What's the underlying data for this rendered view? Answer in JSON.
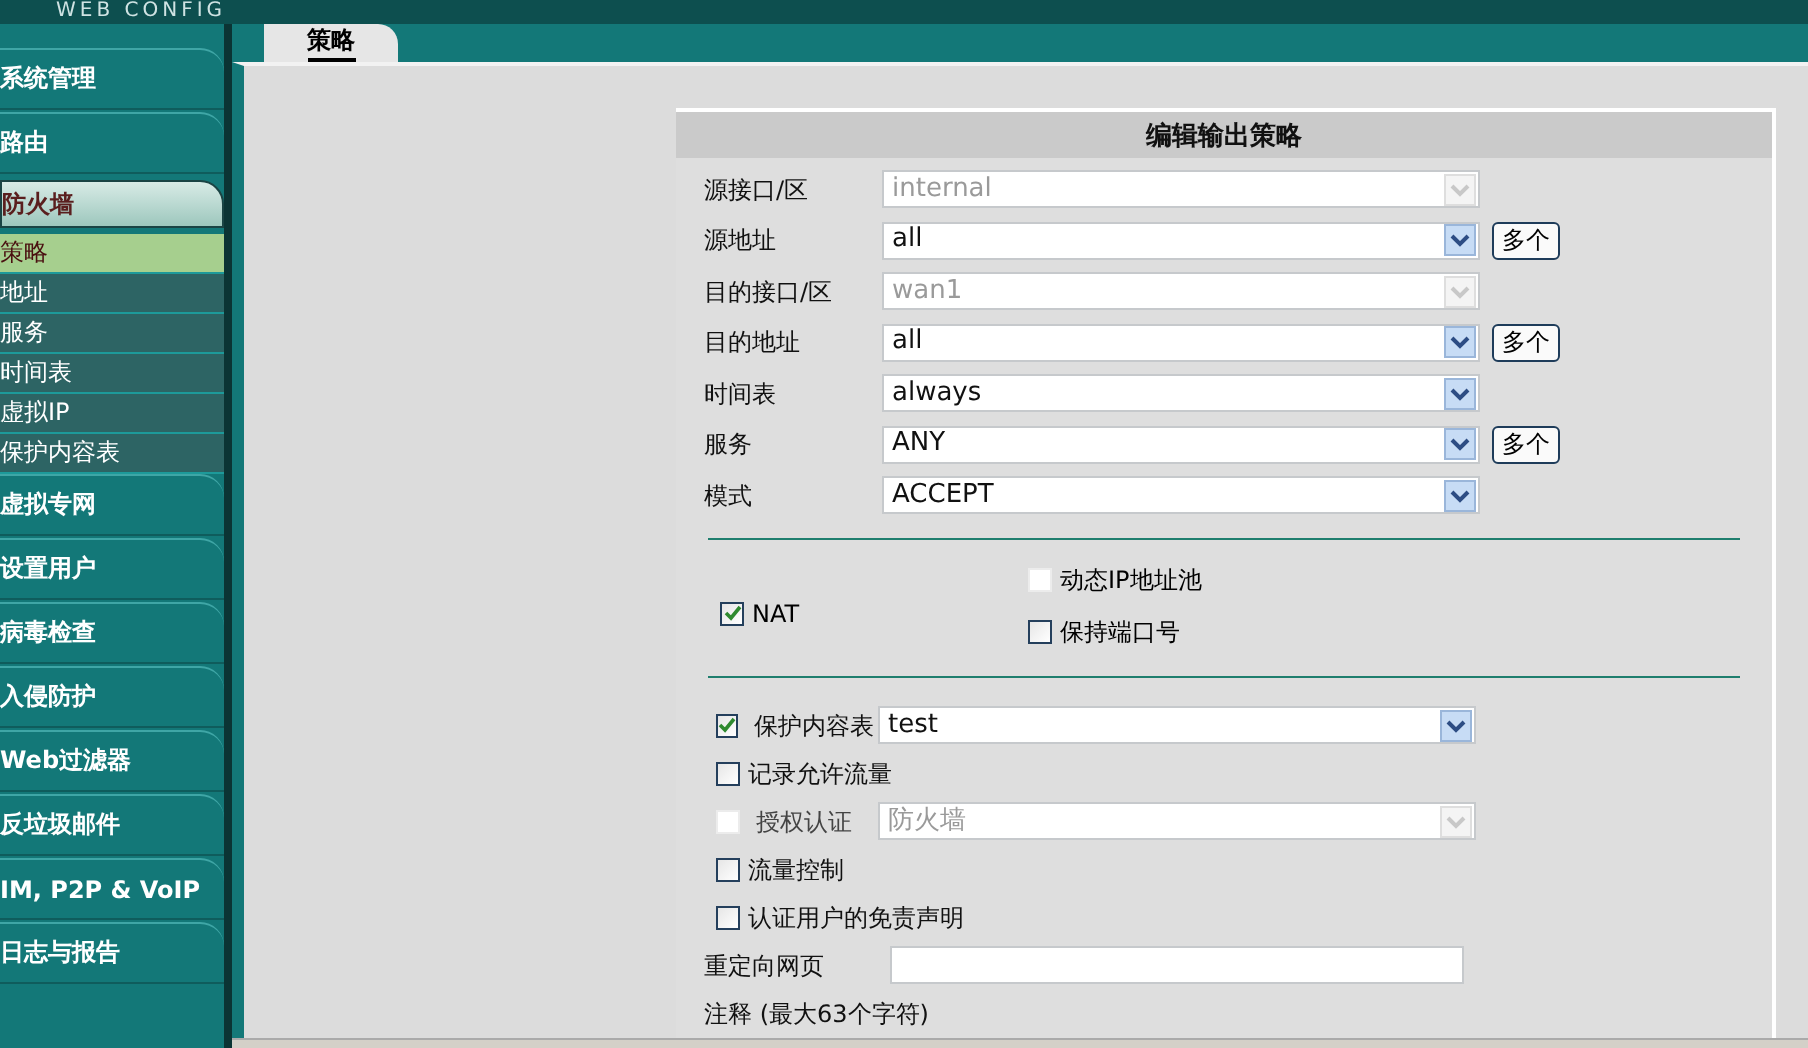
{
  "header": {
    "logo_text": "WEB CONFIG"
  },
  "sidebar": {
    "items": [
      {
        "label": "系统管理",
        "expanded": false
      },
      {
        "label": "路由",
        "expanded": false
      },
      {
        "label": "防火墙",
        "expanded": true,
        "children": [
          {
            "label": "策略",
            "selected": true
          },
          {
            "label": "地址",
            "selected": false
          },
          {
            "label": "服务",
            "selected": false
          },
          {
            "label": "时间表",
            "selected": false
          },
          {
            "label": "虚拟IP",
            "selected": false
          },
          {
            "label": "保护内容表",
            "selected": false
          }
        ]
      },
      {
        "label": "虚拟专网",
        "expanded": false
      },
      {
        "label": "设置用户",
        "expanded": false
      },
      {
        "label": "病毒检查",
        "expanded": false
      },
      {
        "label": "入侵防护",
        "expanded": false
      },
      {
        "label": "Web过滤器",
        "expanded": false
      },
      {
        "label": "反垃圾邮件",
        "expanded": false
      },
      {
        "label": "IM, P2P & VoIP",
        "expanded": false
      },
      {
        "label": "日志与报告",
        "expanded": false
      }
    ]
  },
  "tabs": [
    {
      "label": "策略",
      "selected": true
    }
  ],
  "form": {
    "title": "编辑输出策略",
    "fields": [
      {
        "label": "源接口/区",
        "value": "internal",
        "disabled": true
      },
      {
        "label": "源地址",
        "value": "all",
        "disabled": false,
        "multi_button": "多个"
      },
      {
        "label": "目的接口/区",
        "value": "wan1",
        "disabled": true
      },
      {
        "label": "目的地址",
        "value": "all",
        "disabled": false,
        "multi_button": "多个"
      },
      {
        "label": "时间表",
        "value": "always",
        "disabled": false
      },
      {
        "label": "服务",
        "value": "ANY",
        "disabled": false,
        "multi_button": "多个"
      },
      {
        "label": "模式",
        "value": "ACCEPT",
        "disabled": false
      }
    ],
    "nat": {
      "label": "NAT",
      "checked": true,
      "options": [
        {
          "label": "动态IP地址池",
          "checked": false,
          "disabled": true
        },
        {
          "label": "保持端口号",
          "checked": false,
          "disabled": false
        }
      ]
    },
    "options": [
      {
        "kind": "checkbox_select",
        "label": "保护内容表",
        "checked": true,
        "disabled": false,
        "value": "test"
      },
      {
        "kind": "checkbox",
        "label": "记录允许流量",
        "checked": false,
        "disabled": false
      },
      {
        "kind": "checkbox_select",
        "label": "授权认证",
        "checked": false,
        "disabled": true,
        "value": "防火墙"
      },
      {
        "kind": "checkbox",
        "label": "流量控制",
        "checked": false,
        "disabled": false
      },
      {
        "kind": "checkbox",
        "label": "认证用户的免责声明",
        "checked": false,
        "disabled": false
      },
      {
        "kind": "text_input",
        "label": "重定向网页"
      },
      {
        "kind": "caption",
        "label": "注释 (最大63个字符)"
      }
    ]
  }
}
